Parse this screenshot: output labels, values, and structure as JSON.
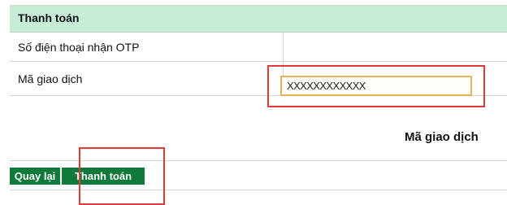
{
  "header": {
    "title": "Thanh toán"
  },
  "form": {
    "phone_label": "Số điện thoại nhận OTP",
    "phone_value": "",
    "txn_label": "Mã giao dịch",
    "txn_value": "XXXXXXXXXXXX",
    "txn_note": "Mã giao dịch"
  },
  "buttons": {
    "back_label": "Quay lại",
    "pay_label": "Thanh toán"
  },
  "colors": {
    "header_bg": "#c6ecd8",
    "button_bg": "#0f7a3a",
    "input_border": "#e8b45a",
    "highlight": "#e03a3a"
  }
}
